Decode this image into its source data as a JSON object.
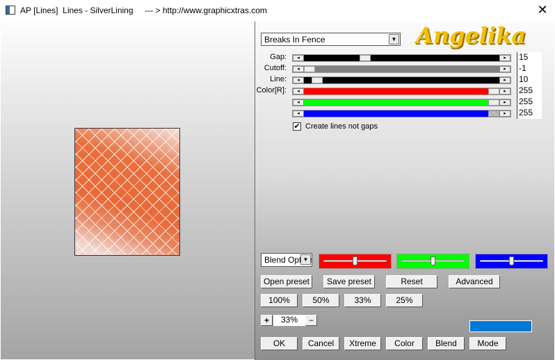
{
  "window": {
    "title": "AP [Lines]  Lines - SilverLining     --- > http://www.graphicxtras.com",
    "close_glyph": "✕"
  },
  "logo": "Angelika",
  "preset_select": {
    "value": "Breaks In Fence"
  },
  "sliders": [
    {
      "label": "Gap:",
      "value": "15",
      "color": "#000000",
      "position": 0.3
    },
    {
      "label": "Cutoff:",
      "value": "-1",
      "color": "#808080",
      "position": 0.0
    },
    {
      "label": "Line:",
      "value": "10",
      "color": "#000000",
      "position": 0.04
    },
    {
      "label": "Color[R]:",
      "value": "255",
      "color": "#ff0000",
      "position": 1.0
    },
    {
      "label": "",
      "value": "255",
      "color": "#00ff00",
      "position": 1.0
    },
    {
      "label": "",
      "value": "255",
      "color": "#0000ff",
      "position": 1.0
    }
  ],
  "checkbox": {
    "label": "Create lines not gaps",
    "checked": true
  },
  "blend_select": {
    "value": "Blend Options"
  },
  "color_sliders": [
    {
      "color": "#ff0000",
      "position": 0.5
    },
    {
      "color": "#00ff00",
      "position": 0.5
    },
    {
      "color": "#0000ff",
      "position": 0.5
    }
  ],
  "buttons": {
    "open_preset": "Open preset",
    "save_preset": "Save preset",
    "reset": "Reset",
    "advanced": "Advanced",
    "z100": "100%",
    "z50": "50%",
    "z33": "33%",
    "z25": "25%",
    "ok": "OK",
    "cancel": "Cancel",
    "xtreme": "Xtreme",
    "color": "Color",
    "blend": "Blend",
    "mode": "Mode"
  },
  "zoom": {
    "plus": "+",
    "minus": "−",
    "value": "33%"
  },
  "swatch_color": "#0078d7"
}
